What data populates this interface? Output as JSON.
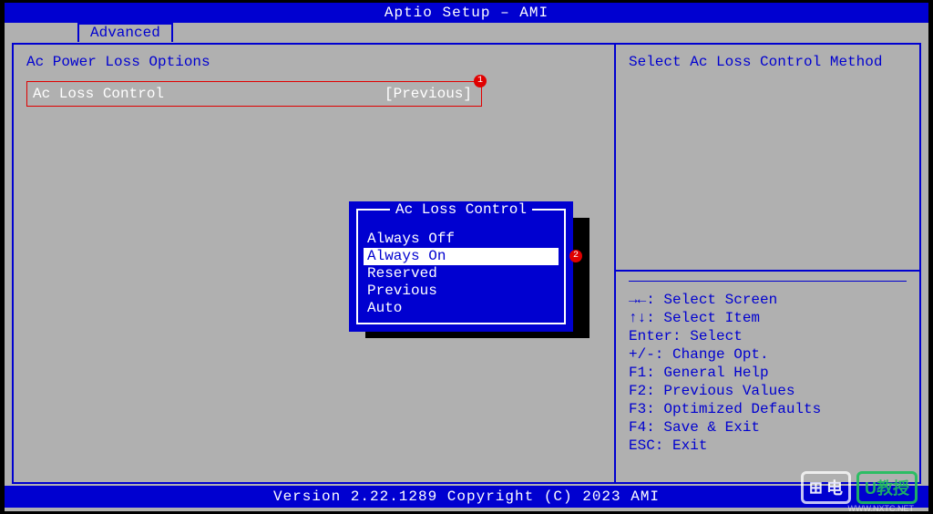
{
  "title": "Aptio Setup – AMI",
  "tab": "Advanced",
  "section_title": "Ac Power Loss Options",
  "setting": {
    "label": "Ac Loss Control",
    "value": "[Previous]",
    "badge": "1"
  },
  "popup": {
    "title": "Ac Loss Control",
    "options": [
      "Always Off",
      "Always On",
      "Reserved",
      "Previous",
      "Auto"
    ],
    "selected_index": 1,
    "badge": "2"
  },
  "help_desc": "Select Ac Loss Control Method",
  "keys": [
    "→←: Select Screen",
    "↑↓: Select Item",
    "Enter: Select",
    "+/-: Change Opt.",
    "F1: General Help",
    "F2: Previous Values",
    "F3: Optimized Defaults",
    "F4: Save & Exit",
    "ESC: Exit"
  ],
  "footer": "Version 2.22.1289 Copyright (C) 2023 AMI",
  "watermark": {
    "a": "电",
    "b": "U教授",
    "sub": "WWW.NXTC.NET"
  }
}
